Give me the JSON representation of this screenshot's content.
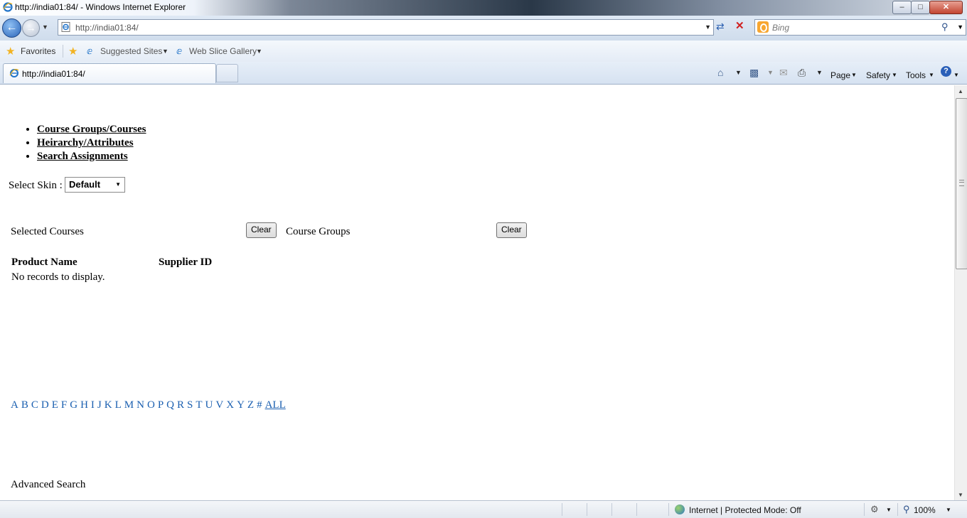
{
  "window": {
    "title": "http://india01:84/ - Windows Internet Explorer",
    "minimize": "–",
    "maximize": "□",
    "close": "✕"
  },
  "navbar": {
    "address": "http://india01:84/",
    "search_placeholder": "Bing"
  },
  "favorites_bar": {
    "favorites_label": "Favorites",
    "suggested_sites": "Suggested Sites",
    "web_slice_gallery": "Web Slice Gallery"
  },
  "tabs": [
    {
      "label": "http://india01:84/"
    }
  ],
  "command_bar": {
    "page": "Page",
    "safety": "Safety",
    "tools": "Tools"
  },
  "page": {
    "nav_links": [
      "Course Groups/Courses",
      "Heirarchy/Attributes",
      "Search Assignments"
    ],
    "select_skin_label": "Select Skin :",
    "skin_value": "Default",
    "selected_courses_label": "Selected Courses",
    "clear_label": "Clear",
    "course_groups_label": "Course Groups",
    "table_headers": [
      "Product Name",
      "Supplier ID"
    ],
    "no_records": "No records to display.",
    "alphabet": [
      "A",
      "B",
      "C",
      "D",
      "E",
      "F",
      "G",
      "H",
      "I",
      "J",
      "K",
      "L",
      "M",
      "N",
      "O",
      "P",
      "Q",
      "R",
      "S",
      "T",
      "U",
      "V",
      "X",
      "Y",
      "Z",
      "#"
    ],
    "all_label": "ALL",
    "advanced_search": "Advanced Search"
  },
  "statusbar": {
    "zone": "Internet | Protected Mode: Off",
    "zoom": "100%"
  },
  "colors": {
    "link_blue": "#1a5fb0",
    "ie_chrome": "#dfe9f5"
  }
}
